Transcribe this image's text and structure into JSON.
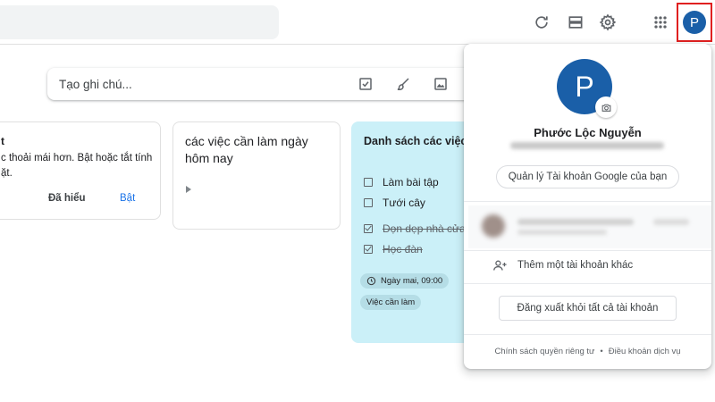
{
  "takenote": {
    "placeholder": "Tạo ghi chú..."
  },
  "notes": {
    "promo": {
      "title": "t",
      "body": "c thoải mái hơn. Bật hoặc tắt tính ặt.",
      "dismiss_label": "Đã hiểu",
      "enable_label": "Bật"
    },
    "todo_today": {
      "title": "các việc cần làm ngày hôm nay"
    },
    "checklist": {
      "title": "Danh sách các việc làm",
      "color": "#cbf0f8",
      "items": [
        {
          "text": "Làm bài tập",
          "checked": false
        },
        {
          "text": "Tưới cây",
          "checked": false
        },
        {
          "text": "Dọn dẹp nhà cửa",
          "checked": true
        },
        {
          "text": "Học đàn",
          "checked": true
        }
      ],
      "reminder": "Ngày mai, 09:00",
      "label": "Việc cần làm"
    }
  },
  "account": {
    "initial": "P",
    "avatar_color": "#1a5fa8",
    "name": "Phước Lộc Nguyễn",
    "manage_label": "Quản lý Tài khoản Google của bạn",
    "add_account_label": "Thêm một tài khoản khác",
    "signout_label": "Đăng xuất khỏi tất cả tài khoản",
    "privacy_label": "Chính sách quyền riêng tư",
    "separator": "•",
    "terms_label": "Điều khoản dịch vụ"
  },
  "icons": {
    "topbar": [
      "refresh-icon",
      "list-view-icon",
      "settings-icon",
      "apps-grid-icon"
    ],
    "takenote": [
      "checkbox-icon",
      "brush-icon",
      "image-icon"
    ]
  }
}
